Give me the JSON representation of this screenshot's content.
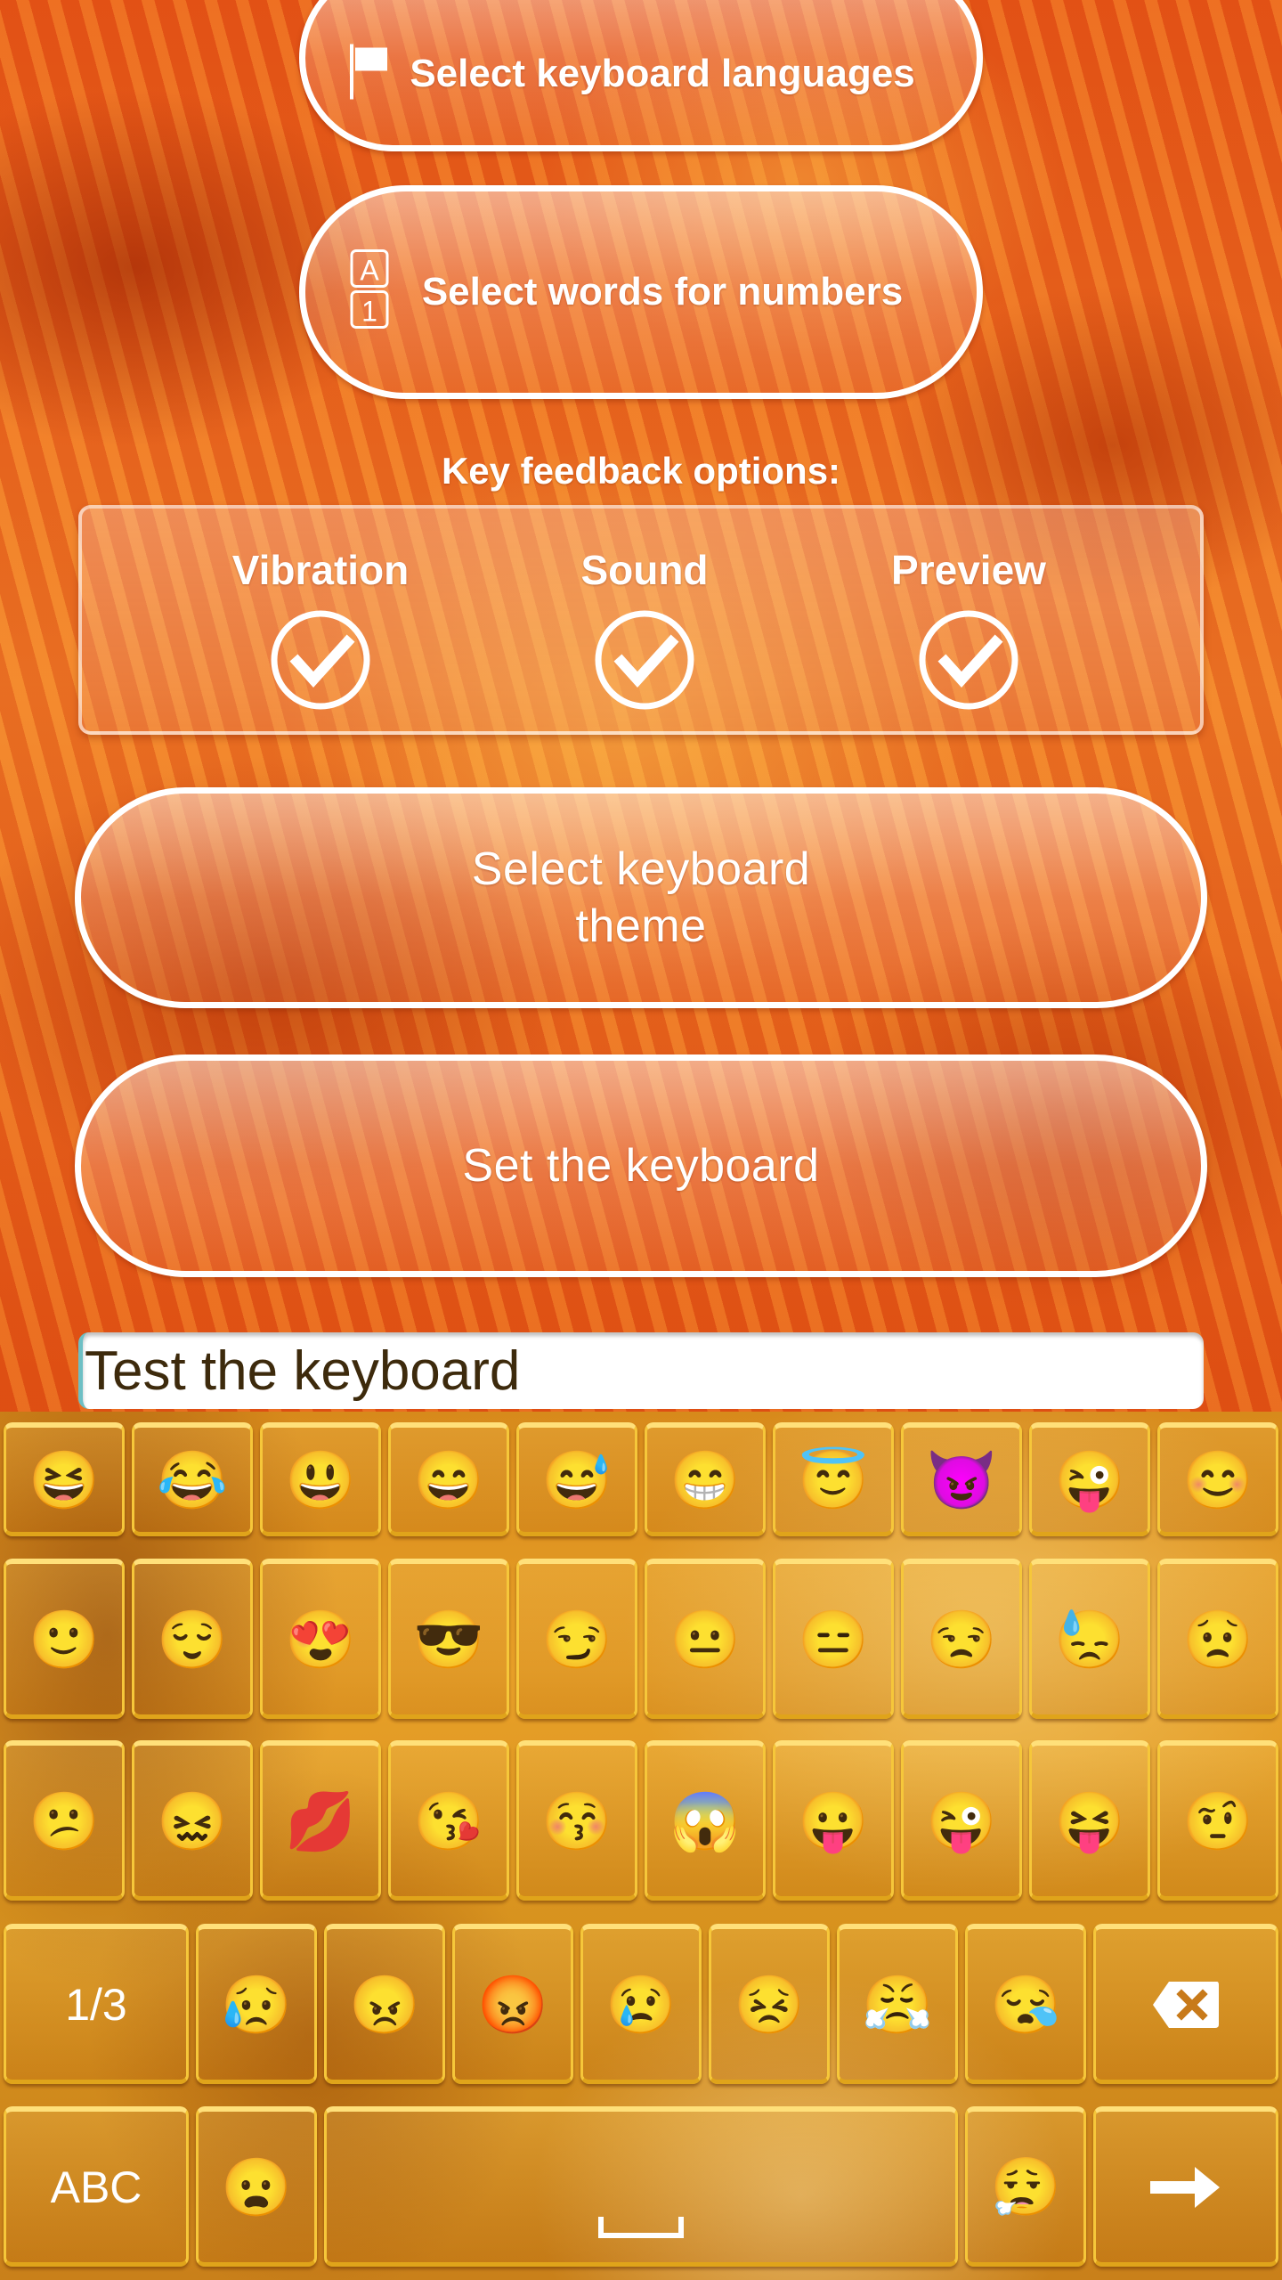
{
  "buttons": {
    "select_languages": {
      "label": "Select keyboard languages",
      "icon": "flag-icon"
    },
    "select_words": {
      "label": "Select words for numbers",
      "icon": "a-1-keys-icon",
      "icon_top": "A",
      "icon_bottom": "1"
    },
    "select_theme": {
      "label_line1": "Select keyboard",
      "label_line2": "theme"
    },
    "set_keyboard": {
      "label": "Set the keyboard"
    }
  },
  "feedback": {
    "title": "Key feedback options:",
    "options": [
      {
        "label": "Vibration",
        "checked": true
      },
      {
        "label": "Sound",
        "checked": true
      },
      {
        "label": "Preview",
        "checked": true
      }
    ]
  },
  "test_field": {
    "value": "Test the keyboard"
  },
  "keyboard": {
    "row1": [
      "😆",
      "😂",
      "😃",
      "😄",
      "😅",
      "😁",
      "😇",
      "😈",
      "😜",
      "😊"
    ],
    "row2": [
      "🙂",
      "😌",
      "😍",
      "😎",
      "😏",
      "😐",
      "😑",
      "😒",
      "😓",
      "😟"
    ],
    "row3": [
      "😕",
      "😖",
      "💋",
      "😘",
      "😚",
      "😱",
      "😛",
      "😜",
      "😝",
      "🤨"
    ],
    "row4": {
      "page_label": "1/3",
      "emojis": [
        "😥",
        "😠",
        "😡",
        "😢",
        "😣",
        "😤",
        "😪"
      ],
      "delete": "backspace-icon"
    },
    "row5": {
      "abc_label": "ABC",
      "emoji_left": "😦",
      "space": "space-icon",
      "emoji_right": "😮‍💨",
      "enter": "arrow-right-icon"
    }
  }
}
